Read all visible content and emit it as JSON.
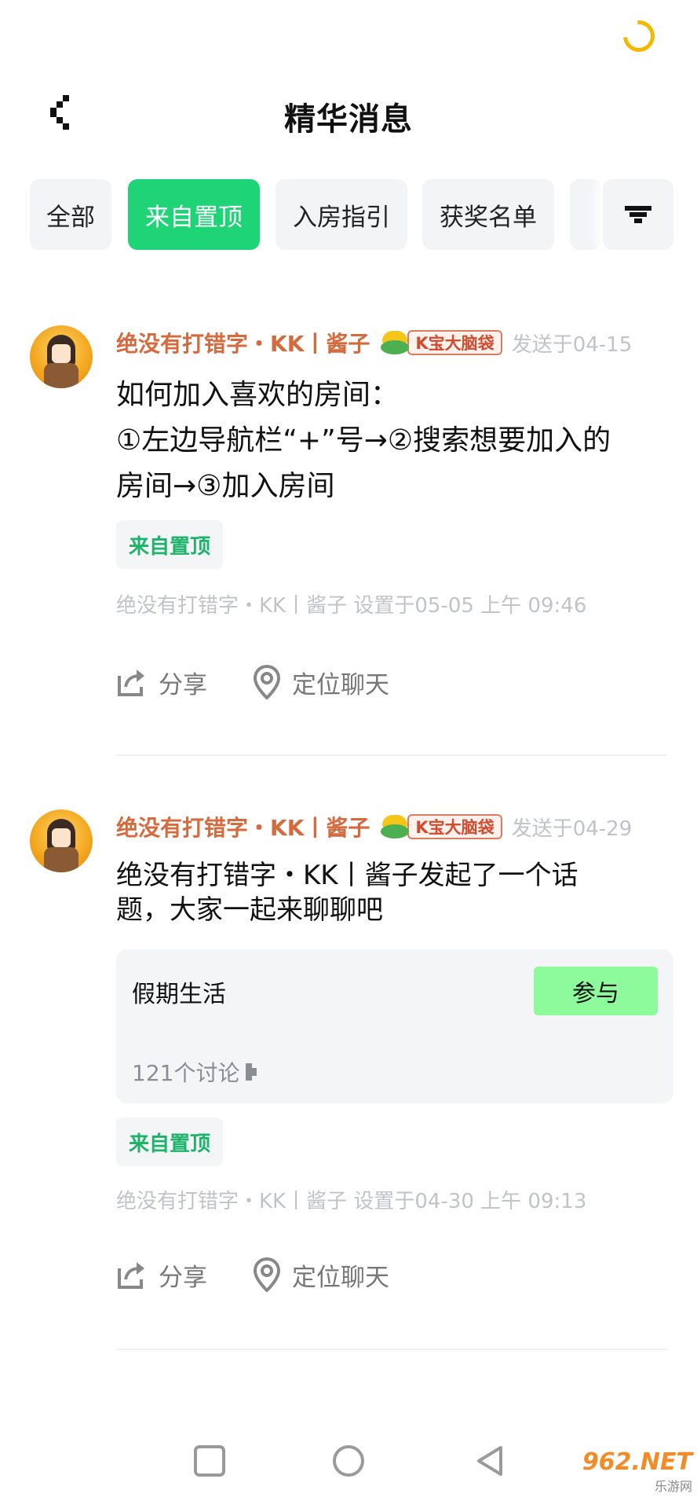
{
  "header": {
    "title": "精华消息"
  },
  "tabs": [
    {
      "label": "全部",
      "active": false
    },
    {
      "label": "来自置顶",
      "active": true
    },
    {
      "label": "入房指引",
      "active": false
    },
    {
      "label": "获奖名单",
      "active": false
    }
  ],
  "posts": [
    {
      "author": "绝没有打错字・KK丨酱子",
      "badge": "K宝大脑袋",
      "sent": "发送于04-15",
      "content_lines": [
        "如何加入喜欢的房间：",
        "①左边导航栏“+”号→②搜索想要加入的",
        "房间→③加入房间"
      ],
      "tag": "来自置顶",
      "pinned_by": "绝没有打错字・KK丨酱子 设置于05-05 上午 09:46",
      "share": "分享",
      "locate": "定位聊天"
    },
    {
      "author": "绝没有打错字・KK丨酱子",
      "badge": "K宝大脑袋",
      "sent": "发送于04-29",
      "content_lines": [
        "绝没有打错字・KK丨酱子发起了一个话",
        "题，大家一起来聊聊吧"
      ],
      "topic": {
        "name": "假期生活",
        "join": "参与",
        "count": "121个讨论"
      },
      "tag": "来自置顶",
      "pinned_by": "绝没有打错字・KK丨酱子 设置于04-30 上午 09:13",
      "share": "分享",
      "locate": "定位聊天"
    }
  ],
  "watermark": {
    "logo": "962.NET",
    "sub": "乐游网"
  },
  "colors": {
    "accent": "#1ed477",
    "author": "#d46a3d",
    "join": "#8dfa9b"
  }
}
